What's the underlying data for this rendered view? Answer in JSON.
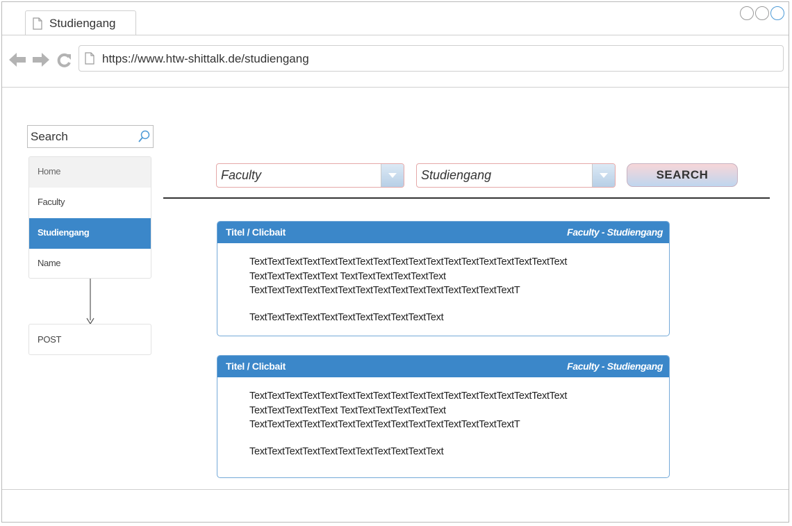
{
  "window": {
    "tab_title": "Studiengang",
    "url": "https://www.htw-shittalk.de/studiengang"
  },
  "sidebar": {
    "search_placeholder": "Search",
    "items": [
      {
        "label": "Home"
      },
      {
        "label": "Faculty"
      },
      {
        "label": "Studiengang"
      },
      {
        "label": "Name"
      }
    ],
    "active_index": 2,
    "post_label": "POST"
  },
  "filters": {
    "faculty": "Faculty",
    "studiengang": "Studiengang",
    "search_label": "SEARCH"
  },
  "posts": [
    {
      "title": "Titel / Clicbait",
      "meta": "Faculty - Studiengang",
      "lines": [
        "TextTextTextTextTextTextTextTextTextTextTextTextTextTextTextTextTextText",
        "TextTextTextTextText TextTextTextTextTextText",
        "TextTextTextTextTextTextTextTextTextTextTextTextTextTextTextT"
      ],
      "last_line": "TextTextTextTextTextTextTextTextTextTextText"
    },
    {
      "title": "Titel / Clicbait",
      "meta": "Faculty - Studiengang",
      "lines": [
        "TextTextTextTextTextTextTextTextTextTextTextTextTextTextTextTextTextText",
        "TextTextTextTextText TextTextTextTextTextText",
        "TextTextTextTextTextTextTextTextTextTextTextTextTextTextTextT"
      ],
      "last_line": "TextTextTextTextTextTextTextTextTextTextText"
    }
  ],
  "colors": {
    "accent": "#3b87c9",
    "select_border": "#e5a8a8"
  }
}
